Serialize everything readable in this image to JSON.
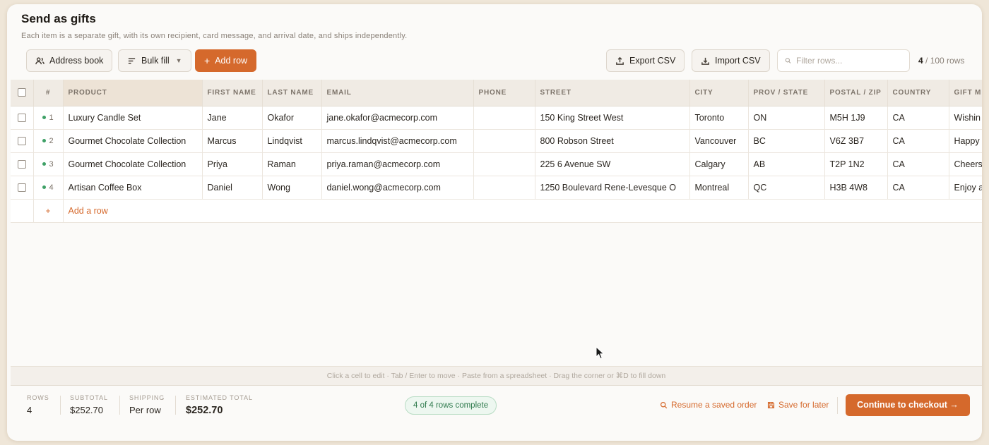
{
  "header": {
    "title": "Send as gifts",
    "subtitle": "Each item is a separate gift, with its own recipient, card message, and arrival date, and ships independently."
  },
  "toolbar": {
    "address_book": "Address book",
    "bulk_fill": "Bulk fill",
    "add_row": "Add row",
    "export_csv": "Export CSV",
    "import_csv": "Import CSV",
    "filter_placeholder": "Filter rows...",
    "row_count_current": "4",
    "row_count_total": "/ 100 rows"
  },
  "table": {
    "columns": [
      "#",
      "PRODUCT",
      "FIRST NAME",
      "LAST NAME",
      "EMAIL",
      "PHONE",
      "STREET",
      "CITY",
      "PROV / STATE",
      "POSTAL / ZIP",
      "COUNTRY",
      "GIFT M"
    ],
    "rows": [
      {
        "num": "1",
        "product": "Luxury Candle Set",
        "first": "Jane",
        "last": "Okafor",
        "email": "jane.okafor@acmecorp.com",
        "phone": "",
        "street": "150 King Street West",
        "city": "Toronto",
        "prov": "ON",
        "postal": "M5H 1J9",
        "country": "CA",
        "gift": "Wishin"
      },
      {
        "num": "2",
        "product": "Gourmet Chocolate Collection",
        "first": "Marcus",
        "last": "Lindqvist",
        "email": "marcus.lindqvist@acmecorp.com",
        "phone": "",
        "street": "800 Robson Street",
        "city": "Vancouver",
        "prov": "BC",
        "postal": "V6Z 3B7",
        "country": "CA",
        "gift": "Happy"
      },
      {
        "num": "3",
        "product": "Gourmet Chocolate Collection",
        "first": "Priya",
        "last": "Raman",
        "email": "priya.raman@acmecorp.com",
        "phone": "",
        "street": "225 6 Avenue SW",
        "city": "Calgary",
        "prov": "AB",
        "postal": "T2P 1N2",
        "country": "CA",
        "gift": "Cheers"
      },
      {
        "num": "4",
        "product": "Artisan Coffee Box",
        "first": "Daniel",
        "last": "Wong",
        "email": "daniel.wong@acmecorp.com",
        "phone": "",
        "street": "1250 Boulevard Rene-Levesque O",
        "city": "Montreal",
        "prov": "QC",
        "postal": "H3B 4W8",
        "country": "CA",
        "gift": "Enjoy a"
      }
    ],
    "add_row_plus": "+",
    "add_row_label": "Add a row"
  },
  "hint": "Click a cell to edit · Tab / Enter to move · Paste from a spreadsheet · Drag the corner or ⌘D to fill down",
  "footer": {
    "rows_label": "ROWS",
    "rows_value": "4",
    "subtotal_label": "SUBTOTAL",
    "subtotal_value": "$252.70",
    "shipping_label": "SHIPPING",
    "shipping_value": "Per row",
    "total_label": "ESTIMATED TOTAL",
    "total_value": "$252.70",
    "complete_badge": "4 of 4 rows complete",
    "resume_label": "Resume a saved order",
    "save_label": "Save for later",
    "checkout_label": "Continue to checkout →"
  },
  "colors": {
    "accent": "#d5692c",
    "status_ok": "#3ea066"
  },
  "icons": [
    "users-icon",
    "filter-lines-icon",
    "export-icon",
    "import-icon",
    "search-icon",
    "save-icon",
    "cursor-icon"
  ]
}
